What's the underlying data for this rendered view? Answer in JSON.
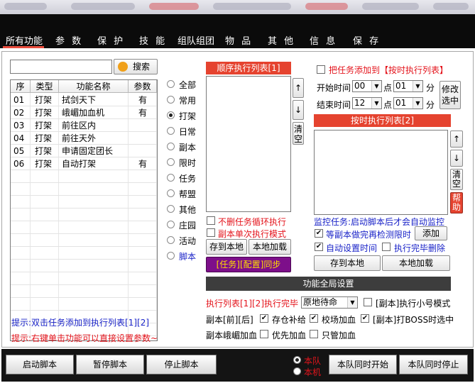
{
  "tabs": [
    "所有功能",
    "参 数",
    "保 护",
    "技 能",
    "组队组团",
    "物 品",
    "其 他",
    "信 息",
    "保 存"
  ],
  "search": {
    "value": "",
    "button_label": "搜索"
  },
  "table": {
    "headers": [
      "序",
      "类型",
      "功能名称",
      "参数"
    ],
    "rows": [
      [
        "01",
        "打架",
        "拭剑天下",
        "有"
      ],
      [
        "02",
        "打架",
        "峨嵋加血机",
        "有"
      ],
      [
        "03",
        "打架",
        "前往区内",
        ""
      ],
      [
        "04",
        "打架",
        "前往天外",
        ""
      ],
      [
        "05",
        "打架",
        "申请固定团长",
        ""
      ],
      [
        "06",
        "打架",
        "自动打架",
        "有"
      ]
    ]
  },
  "categories": [
    "全部",
    "常用",
    "打架",
    "日常",
    "副本",
    "限时",
    "任务",
    "帮盟",
    "其他",
    "庄园",
    "活动",
    "脚本"
  ],
  "selected_category": "打架",
  "sequential": {
    "title": "顺序执行列表[1]",
    "up": "↑",
    "down": "↓",
    "clear": "清空",
    "opt_no_delete": "不删任务循环执行",
    "opt_single": "副本单次执行模式",
    "save_btn": "存到本地",
    "load_btn": "本地加载",
    "sync_btn": "[任务][配置]同步"
  },
  "timed": {
    "add_to_label": "把任务添加到【按时执行列表】",
    "start_label": "开始时间",
    "start_hour": "00",
    "start_min": "01",
    "end_label": "结束时间",
    "end_hour": "12",
    "end_min": "01",
    "point": "点",
    "minute": "分",
    "modify_btn": "修改选中",
    "title": "按时执行列表[2]",
    "up": "↑",
    "down": "↓",
    "clear": "清空",
    "help": "帮助",
    "monitor_text": "监控任务:启动脚本后才会自动监控",
    "wait_label": "等副本做完再检测限时",
    "add_btn": "添加",
    "auto_time_label": "自动设置时间",
    "del_after_label": "执行完毕删除",
    "save_btn": "存到本地",
    "load_btn": "本地加载"
  },
  "global": {
    "title": "功能全局设置",
    "exec_label": "执行列表[1][2]执行完毕",
    "exec_option": "原地待命",
    "small_mode_label": "[副本]执行小号模式",
    "before_after": "副本[前][后]",
    "store_label": "存仓补给",
    "school_label": "校场加血",
    "boss_label": "[副本]打BOSS时选中",
    "emei_label": "副本峨嵋加血",
    "priority_label": "优先加血",
    "only_label": "只管加血"
  },
  "hints": {
    "hint1": "提示:双击任务添加到执行列表[1][2]",
    "hint2": "提示:右键单击功能可以直接设置参数~"
  },
  "bottom": {
    "start": "启动脚本",
    "pause": "暂停脚本",
    "stop": "停止脚本",
    "team_local": "本队",
    "this_machine": "本机",
    "team_start": "本队同时开始",
    "team_stop": "本队同时停止"
  },
  "colors": {
    "accent_red": "#e5432f",
    "tab_bar": "#0b0b0b",
    "section_header": "#3d3d3d",
    "sync_purple": "#7d0f8a",
    "sync_text": "#ffde00"
  }
}
